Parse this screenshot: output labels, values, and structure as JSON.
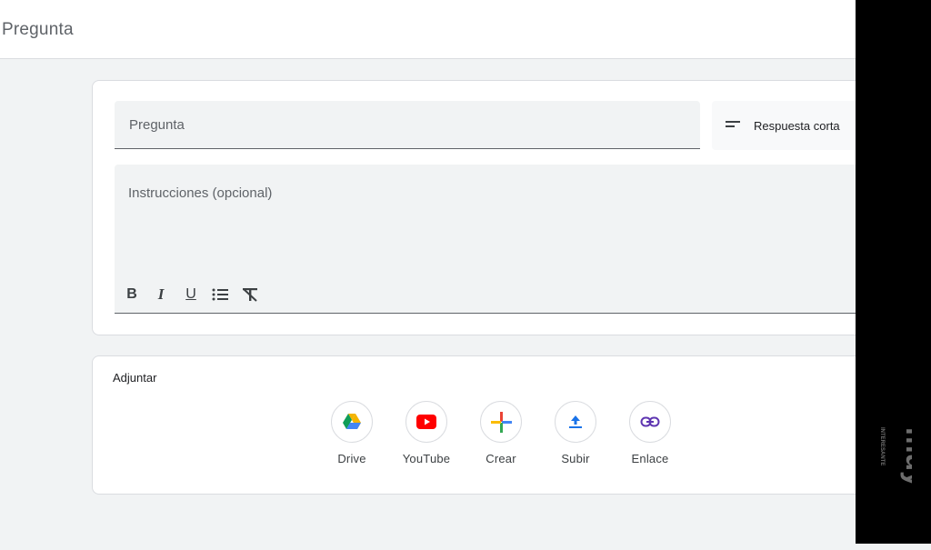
{
  "header": {
    "title": "Pregunta"
  },
  "question": {
    "placeholder": "Pregunta",
    "type_label": "Respuesta corta",
    "type_icon": "short-text-icon",
    "instructions_placeholder": "Instrucciones (opcional)"
  },
  "format_toolbar": [
    {
      "name": "bold-icon",
      "glyph": "B"
    },
    {
      "name": "italic-icon",
      "glyph": "I"
    },
    {
      "name": "underline-icon",
      "glyph": "U"
    },
    {
      "name": "bulleted-list-icon",
      "glyph": "list"
    },
    {
      "name": "clear-formatting-icon",
      "glyph": "Tx"
    }
  ],
  "attach": {
    "title": "Adjuntar",
    "options": [
      {
        "label": "Drive",
        "icon": "google-drive-icon"
      },
      {
        "label": "YouTube",
        "icon": "youtube-icon"
      },
      {
        "label": "Crear",
        "icon": "create-plus-icon"
      },
      {
        "label": "Subir",
        "icon": "upload-icon"
      },
      {
        "label": "Enlace",
        "icon": "link-icon"
      }
    ]
  },
  "watermark": {
    "text": "muy interesante"
  },
  "colors": {
    "background": "#f1f3f4",
    "card": "#ffffff",
    "border": "#dadce0",
    "drive_green": "#0f9d58",
    "drive_yellow": "#f4b400",
    "drive_blue": "#4285f4",
    "youtube_red": "#ff0000",
    "accent_blue": "#1a73e8",
    "link_purple": "#5e35b1"
  }
}
